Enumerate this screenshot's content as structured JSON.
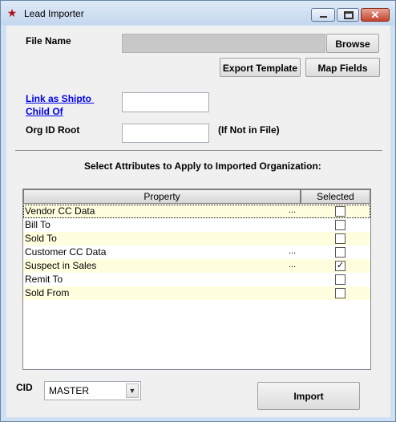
{
  "window": {
    "title": "Lead Importer",
    "controls": {
      "minimize": "minimize",
      "maximize": "maximize",
      "close": "✕"
    }
  },
  "form": {
    "file_name_label": "File Name",
    "file_name_value": "",
    "browse_label": "Browse",
    "export_template_label": "Export Template",
    "map_fields_label": "Map Fields",
    "link_label_line1": "Link as Shipto ",
    "link_label_line2": "Child Of",
    "link_value": "",
    "org_id_root_label": "Org ID Root",
    "org_id_root_value": "",
    "org_id_hint": "(If Not in File)"
  },
  "attributes": {
    "heading": "Select Attributes to Apply to Imported Organization:",
    "columns": {
      "property": "Property",
      "selected": "Selected"
    },
    "rows": [
      {
        "name": "Vendor CC Data",
        "ellipsis": "...",
        "checked": false
      },
      {
        "name": "Bill To",
        "ellipsis": "",
        "checked": false
      },
      {
        "name": "Sold To",
        "ellipsis": "",
        "checked": false
      },
      {
        "name": "Customer CC Data",
        "ellipsis": "...",
        "checked": false
      },
      {
        "name": "Suspect in Sales",
        "ellipsis": "...",
        "checked": true
      },
      {
        "name": "Remit To",
        "ellipsis": "",
        "checked": false
      },
      {
        "name": "Sold From",
        "ellipsis": "",
        "checked": false
      }
    ]
  },
  "footer": {
    "cid_label": "CID",
    "cid_value": "MASTER",
    "import_label": "Import"
  },
  "colors": {
    "alt_row": "#ffffe0",
    "link": "#0000ee",
    "close_button": "#c2432b"
  }
}
